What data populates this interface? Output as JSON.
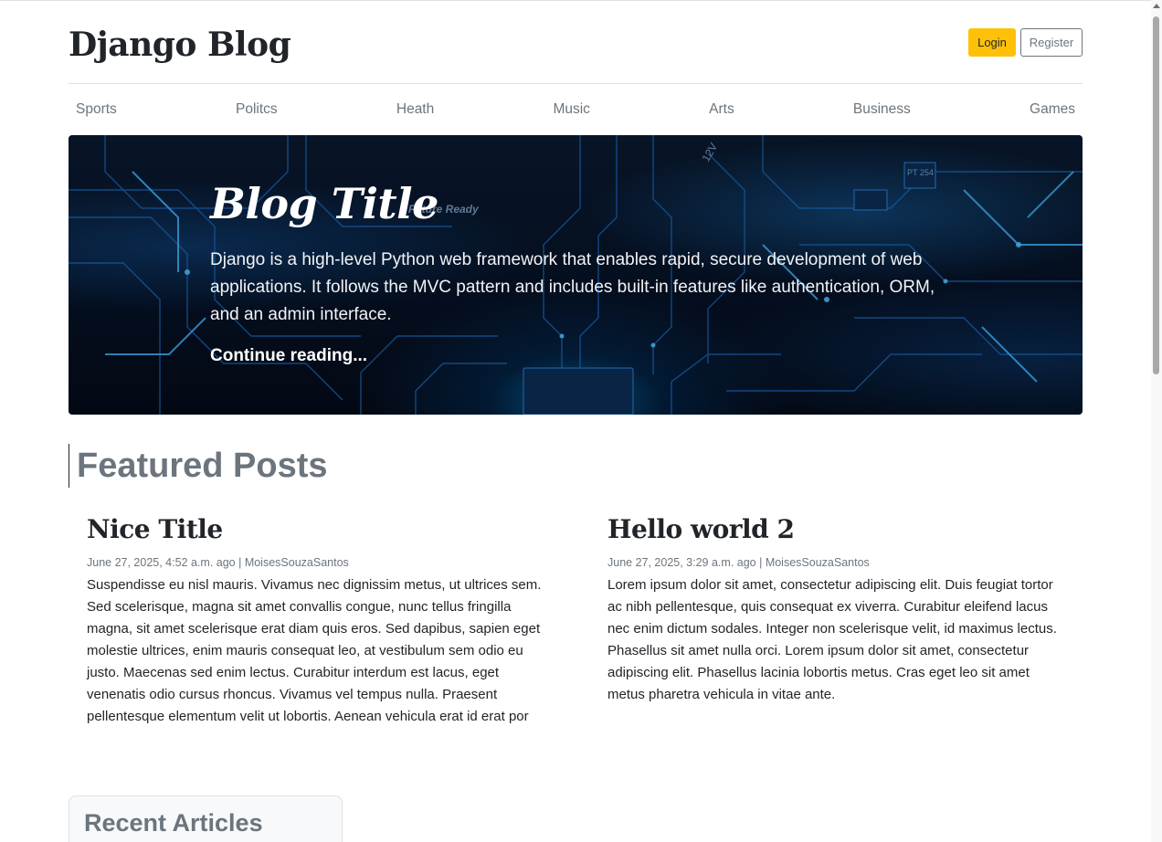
{
  "header": {
    "logo": "Django Blog",
    "login_label": "Login",
    "register_label": "Register"
  },
  "nav": {
    "items": [
      "Sports",
      "Politcs",
      "Heath",
      "Music",
      "Arts",
      "Business",
      "Games"
    ]
  },
  "hero": {
    "title": "Blog Title",
    "text": "Django is a high-level Python web framework that enables rapid, secure development of web applications. It follows the MVC pattern and includes built-in features like authentication, ORM, and an admin interface.",
    "link_label": "Continue reading...",
    "image_labels": [
      "Future Ready",
      "12V",
      "PT 254"
    ]
  },
  "featured": {
    "heading": "Featured Posts",
    "posts": [
      {
        "title": "Nice Title",
        "meta": "June 27, 2025, 4:52 a.m. ago | MoisesSouzaSantos",
        "body": "Suspendisse eu nisl mauris. Vivamus nec dignissim metus, ut ultrices sem. Sed scelerisque, magna sit amet convallis congue, nunc tellus fringilla magna, sit amet scelerisque erat diam quis eros. Sed dapibus, sapien eget molestie ultrices, enim mauris consequat leo, at vestibulum sem odio eu justo. Maecenas sed enim lectus. Curabitur interdum est lacus, eget venenatis odio cursus rhoncus. Vivamus vel tempus nulla. Praesent pellentesque elementum velit ut lobortis. Aenean vehicula erat id erat por"
      },
      {
        "title": "Hello world 2",
        "meta": "June 27, 2025, 3:29 a.m. ago | MoisesSouzaSantos",
        "body": "Lorem ipsum dolor sit amet, consectetur adipiscing elit. Duis feugiat tortor ac nibh pellentesque, quis consequat ex viverra. Curabitur eleifend lacus nec enim dictum sodales. Integer non scelerisque velit, id maximus lectus. Phasellus sit amet nulla orci. Lorem ipsum dolor sit amet, consectetur adipiscing elit. Phasellus lacinia lobortis metus. Cras eget leo sit amet metus pharetra vehicula in vitae ante."
      }
    ]
  },
  "recent": {
    "heading": "Recent Articles"
  },
  "colors": {
    "accent": "#ffc107",
    "muted": "#6c757d",
    "text": "#212529",
    "hero_dark": "#061226",
    "circuit_blue": "#1e8fff"
  }
}
